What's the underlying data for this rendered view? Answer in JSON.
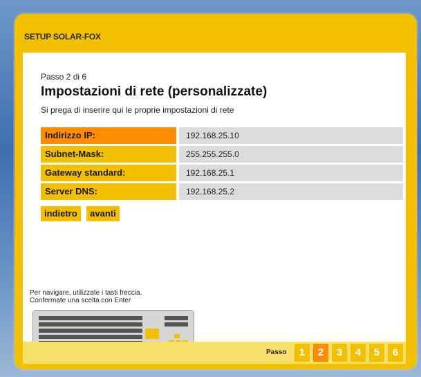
{
  "window": {
    "title": "SETUP SOLAR-FOX"
  },
  "page": {
    "step_of": "Passo 2 di 6",
    "heading": "Impostazioni di rete (personalizzate)",
    "subtitle": "Si prega di inserire qui le proprie impostazioni di rete"
  },
  "settings": [
    {
      "label": "Indirizzo IP:",
      "value": "192.168.25.10",
      "active": true
    },
    {
      "label": "Subnet-Mask:",
      "value": "255.255.255.0",
      "active": false
    },
    {
      "label": "Gateway standard:",
      "value": "192.168.25.1",
      "active": false
    },
    {
      "label": "Server DNS:",
      "value": "192.168.25.2",
      "active": false
    }
  ],
  "buttons": {
    "back": "indietro",
    "next": "avanti"
  },
  "hint": {
    "line1": "Per navigare, utilizzate i tasti freccia.",
    "line2": "Confermate una scelta con Enter"
  },
  "footer": {
    "label": "Passo",
    "steps": [
      "1",
      "2",
      "3",
      "4",
      "5",
      "6"
    ],
    "current_step": "2"
  },
  "colors": {
    "accent": "#f3c000",
    "active": "#ff8c00",
    "value_bg": "#dcdcdc"
  }
}
